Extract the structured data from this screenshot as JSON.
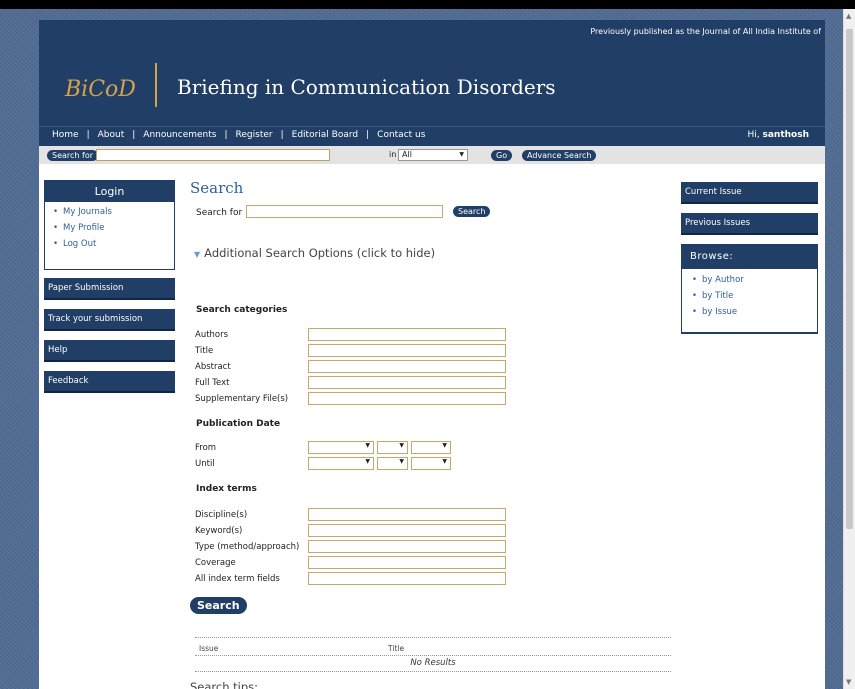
{
  "header": {
    "note": "Previously published as the Journal of All India Institute of",
    "logo": "BiCoD",
    "title": "Briefing in Communication Disorders"
  },
  "nav": {
    "items": [
      "Home",
      "About",
      "Announcements",
      "Register",
      "Editorial Board",
      "Contact us"
    ],
    "greeting_prefix": "Hi, ",
    "username": "santhosh"
  },
  "top_search": {
    "label": "Search for",
    "value": "",
    "in_label": "in",
    "scope_selected": "All",
    "go_label": "Go",
    "advanced_label": "Advance Search"
  },
  "sidebar_left": {
    "login_title": "Login",
    "links": [
      "My Journals",
      "My Profile",
      "Log Out"
    ],
    "buttons": [
      "Paper Submission",
      "Track your submission",
      "Help",
      "Feedback"
    ]
  },
  "sidebar_right": {
    "buttons": [
      "Current Issue",
      "Previous Issues"
    ],
    "browse_title": "Browse:",
    "browse_links": [
      "by Author",
      "by Title",
      "by Issue"
    ]
  },
  "main": {
    "title": "Search",
    "search_for_label": "Search for",
    "search_for_value": "",
    "search_button": "Search",
    "additional_options": "Additional Search Options (click to hide)",
    "categories_title": "Search categories",
    "categories": [
      "Authors",
      "Title",
      "Abstract",
      "Full Text",
      "Supplementary File(s)"
    ],
    "date_title": "Publication Date",
    "date_from": "From",
    "date_until": "Until",
    "index_title": "Index terms",
    "index_terms": [
      "Discipline(s)",
      "Keyword(s)",
      "Type (method/approach)",
      "Coverage",
      "All index term fields"
    ],
    "submit_label": "Search",
    "table_headers": [
      "Issue",
      "Title"
    ],
    "no_results": "No Results",
    "tips": "Search tips:"
  }
}
